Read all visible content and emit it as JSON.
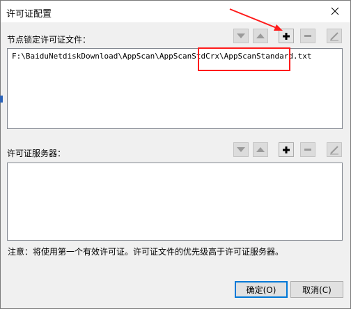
{
  "window": {
    "title": "许可证配置"
  },
  "node_locked": {
    "label": "节点锁定许可证文件：",
    "items": [
      "F:\\BaiduNetdiskDownload\\AppScan\\AppScanStdCrx\\AppScanStandard.txt"
    ]
  },
  "license_server": {
    "label": "许可证服务器：",
    "items": []
  },
  "toolbar_icons": [
    "move-down-icon",
    "move-up-icon",
    "add-icon",
    "remove-icon",
    "edit-icon"
  ],
  "note": "注意：将使用第一个有效许可证。许可证文件的优先级高于许可证服务器。",
  "buttons": {
    "ok": "确定(O)",
    "cancel": "取消(C)"
  },
  "colors": {
    "annotation": "#ff1a1a",
    "default_button_border": "#0078d7"
  }
}
